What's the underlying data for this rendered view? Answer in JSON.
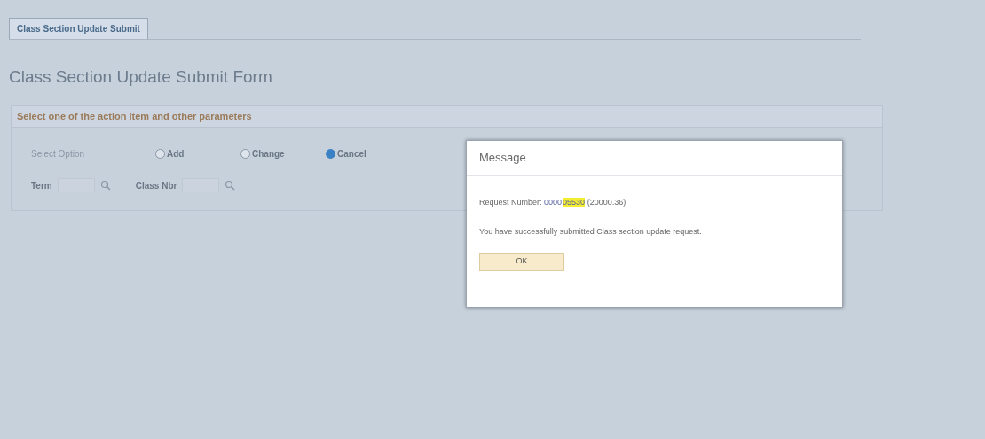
{
  "tabs": [
    {
      "label": "Class Section Update Submit",
      "selected": true
    }
  ],
  "page_title": "Class Section Update Submit Form",
  "section": {
    "header": "Select one of the action item and other parameters",
    "option_label": "Select Option",
    "options": [
      {
        "label": "Add",
        "selected": false
      },
      {
        "label": "Change",
        "selected": false
      },
      {
        "label": "Cancel",
        "selected": true
      }
    ],
    "fields": [
      {
        "label": "Term"
      },
      {
        "label": "Class Nbr"
      }
    ]
  },
  "dialog": {
    "title": "Message",
    "request_label": "Request Number:",
    "request_prefix": "0000",
    "request_highlight": "05530",
    "request_suffix": "(20000.36)",
    "message": "You have successfully submitted Class section update request.",
    "button": "OK"
  }
}
